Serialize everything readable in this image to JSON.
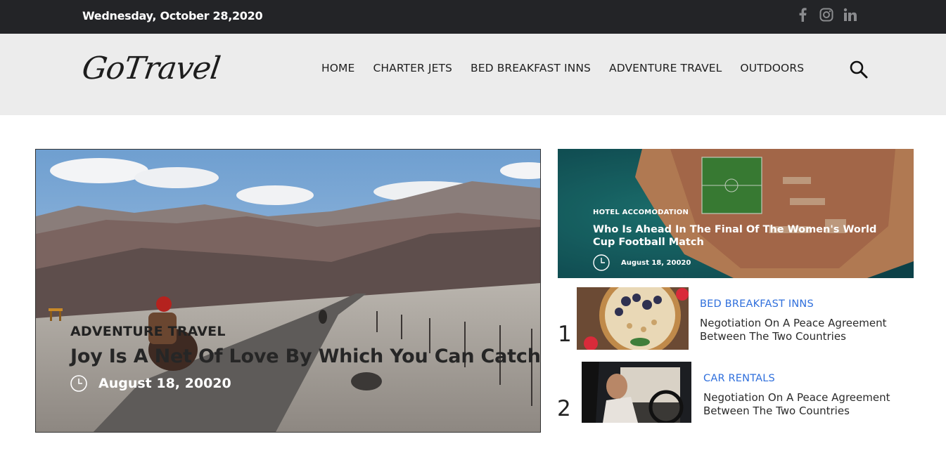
{
  "topbar": {
    "date": "Wednesday, October 28,2020"
  },
  "social": {
    "icons": [
      "facebook-icon",
      "instagram-icon",
      "linkedin-icon"
    ]
  },
  "header": {
    "logo": "GoTravel",
    "nav": [
      "HOME",
      "CHARTER JETS",
      "BED BREAKFAST INNS",
      "ADVENTURE TRAVEL",
      "OUTDOORS"
    ]
  },
  "hero": {
    "category": "ADVENTURE TRAVEL",
    "title": "Joy Is A Net Of Love By Which You Can Catch",
    "date": "August 18, 20020"
  },
  "feature": {
    "category": "HOTEL ACCOMODATION",
    "title": "Who Is Ahead In The Final Of The Women's World Cup Football Match",
    "date": "August 18, 20020"
  },
  "list": [
    {
      "number": "1",
      "category": "BED BREAKFAST INNS",
      "title": "Negotiation On A Peace Agreement Between The Two Countries"
    },
    {
      "number": "2",
      "category": "CAR RENTALS",
      "title": "Negotiation On A Peace Agreement Between The Two Countries"
    }
  ],
  "colors": {
    "topbar": "#232427",
    "header": "#ececec",
    "link_blue": "#2f6fdc"
  }
}
